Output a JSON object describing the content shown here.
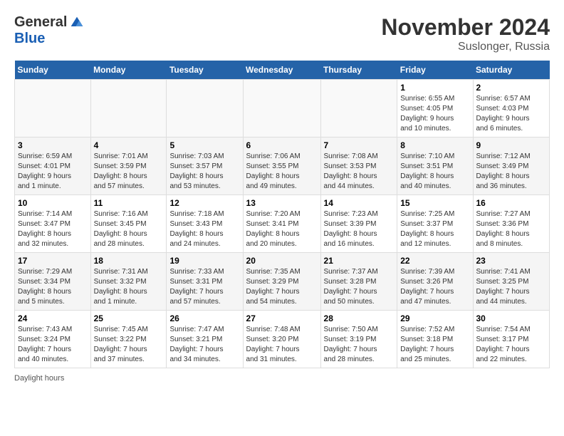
{
  "logo": {
    "general": "General",
    "blue": "Blue",
    "tagline": "GeneralBlue"
  },
  "title": "November 2024",
  "location": "Suslonger, Russia",
  "footer": "Daylight hours",
  "days_header": [
    "Sunday",
    "Monday",
    "Tuesday",
    "Wednesday",
    "Thursday",
    "Friday",
    "Saturday"
  ],
  "weeks": [
    [
      {
        "day": "",
        "info": ""
      },
      {
        "day": "",
        "info": ""
      },
      {
        "day": "",
        "info": ""
      },
      {
        "day": "",
        "info": ""
      },
      {
        "day": "",
        "info": ""
      },
      {
        "day": "1",
        "info": "Sunrise: 6:55 AM\nSunset: 4:05 PM\nDaylight: 9 hours\nand 10 minutes."
      },
      {
        "day": "2",
        "info": "Sunrise: 6:57 AM\nSunset: 4:03 PM\nDaylight: 9 hours\nand 6 minutes."
      }
    ],
    [
      {
        "day": "3",
        "info": "Sunrise: 6:59 AM\nSunset: 4:01 PM\nDaylight: 9 hours\nand 1 minute."
      },
      {
        "day": "4",
        "info": "Sunrise: 7:01 AM\nSunset: 3:59 PM\nDaylight: 8 hours\nand 57 minutes."
      },
      {
        "day": "5",
        "info": "Sunrise: 7:03 AM\nSunset: 3:57 PM\nDaylight: 8 hours\nand 53 minutes."
      },
      {
        "day": "6",
        "info": "Sunrise: 7:06 AM\nSunset: 3:55 PM\nDaylight: 8 hours\nand 49 minutes."
      },
      {
        "day": "7",
        "info": "Sunrise: 7:08 AM\nSunset: 3:53 PM\nDaylight: 8 hours\nand 44 minutes."
      },
      {
        "day": "8",
        "info": "Sunrise: 7:10 AM\nSunset: 3:51 PM\nDaylight: 8 hours\nand 40 minutes."
      },
      {
        "day": "9",
        "info": "Sunrise: 7:12 AM\nSunset: 3:49 PM\nDaylight: 8 hours\nand 36 minutes."
      }
    ],
    [
      {
        "day": "10",
        "info": "Sunrise: 7:14 AM\nSunset: 3:47 PM\nDaylight: 8 hours\nand 32 minutes."
      },
      {
        "day": "11",
        "info": "Sunrise: 7:16 AM\nSunset: 3:45 PM\nDaylight: 8 hours\nand 28 minutes."
      },
      {
        "day": "12",
        "info": "Sunrise: 7:18 AM\nSunset: 3:43 PM\nDaylight: 8 hours\nand 24 minutes."
      },
      {
        "day": "13",
        "info": "Sunrise: 7:20 AM\nSunset: 3:41 PM\nDaylight: 8 hours\nand 20 minutes."
      },
      {
        "day": "14",
        "info": "Sunrise: 7:23 AM\nSunset: 3:39 PM\nDaylight: 8 hours\nand 16 minutes."
      },
      {
        "day": "15",
        "info": "Sunrise: 7:25 AM\nSunset: 3:37 PM\nDaylight: 8 hours\nand 12 minutes."
      },
      {
        "day": "16",
        "info": "Sunrise: 7:27 AM\nSunset: 3:36 PM\nDaylight: 8 hours\nand 8 minutes."
      }
    ],
    [
      {
        "day": "17",
        "info": "Sunrise: 7:29 AM\nSunset: 3:34 PM\nDaylight: 8 hours\nand 5 minutes."
      },
      {
        "day": "18",
        "info": "Sunrise: 7:31 AM\nSunset: 3:32 PM\nDaylight: 8 hours\nand 1 minute."
      },
      {
        "day": "19",
        "info": "Sunrise: 7:33 AM\nSunset: 3:31 PM\nDaylight: 7 hours\nand 57 minutes."
      },
      {
        "day": "20",
        "info": "Sunrise: 7:35 AM\nSunset: 3:29 PM\nDaylight: 7 hours\nand 54 minutes."
      },
      {
        "day": "21",
        "info": "Sunrise: 7:37 AM\nSunset: 3:28 PM\nDaylight: 7 hours\nand 50 minutes."
      },
      {
        "day": "22",
        "info": "Sunrise: 7:39 AM\nSunset: 3:26 PM\nDaylight: 7 hours\nand 47 minutes."
      },
      {
        "day": "23",
        "info": "Sunrise: 7:41 AM\nSunset: 3:25 PM\nDaylight: 7 hours\nand 44 minutes."
      }
    ],
    [
      {
        "day": "24",
        "info": "Sunrise: 7:43 AM\nSunset: 3:24 PM\nDaylight: 7 hours\nand 40 minutes."
      },
      {
        "day": "25",
        "info": "Sunrise: 7:45 AM\nSunset: 3:22 PM\nDaylight: 7 hours\nand 37 minutes."
      },
      {
        "day": "26",
        "info": "Sunrise: 7:47 AM\nSunset: 3:21 PM\nDaylight: 7 hours\nand 34 minutes."
      },
      {
        "day": "27",
        "info": "Sunrise: 7:48 AM\nSunset: 3:20 PM\nDaylight: 7 hours\nand 31 minutes."
      },
      {
        "day": "28",
        "info": "Sunrise: 7:50 AM\nSunset: 3:19 PM\nDaylight: 7 hours\nand 28 minutes."
      },
      {
        "day": "29",
        "info": "Sunrise: 7:52 AM\nSunset: 3:18 PM\nDaylight: 7 hours\nand 25 minutes."
      },
      {
        "day": "30",
        "info": "Sunrise: 7:54 AM\nSunset: 3:17 PM\nDaylight: 7 hours\nand 22 minutes."
      }
    ]
  ]
}
